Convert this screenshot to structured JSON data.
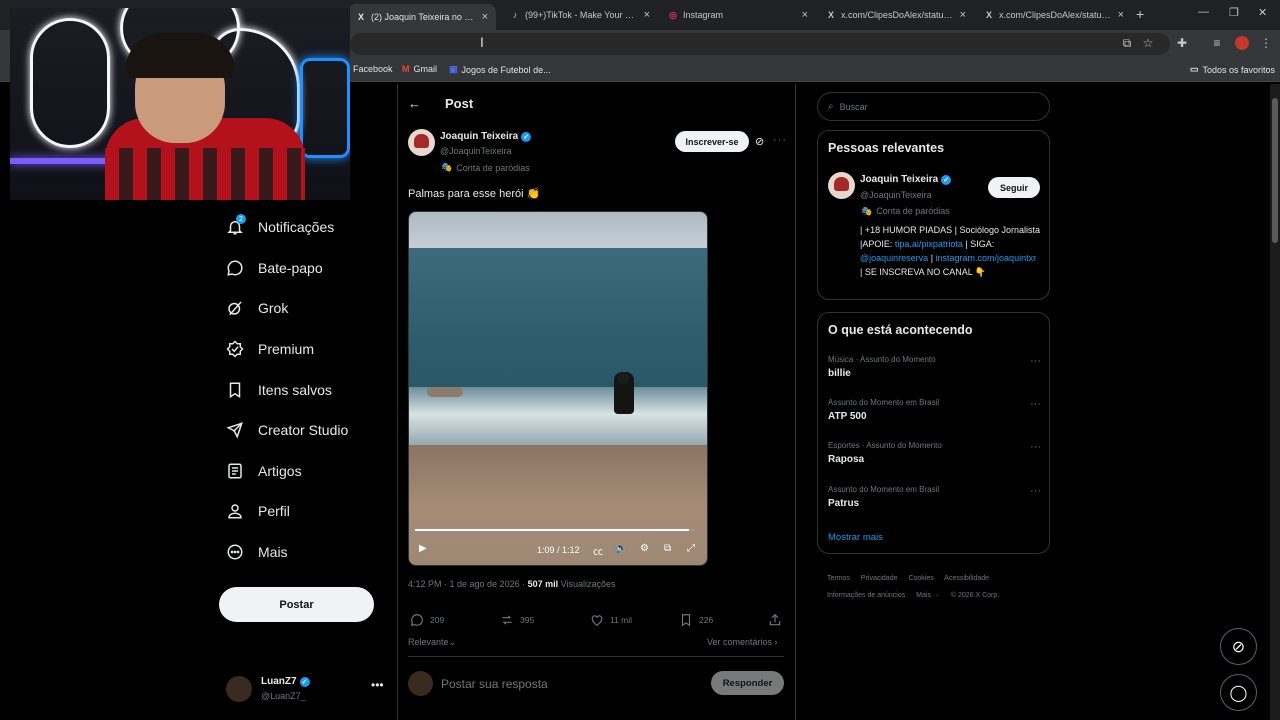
{
  "browser": {
    "tabs": [
      {
        "title": "(2) Joaquin Teixeira no X: \"Palm",
        "favicon": "X",
        "active": true
      },
      {
        "title": "(99+)TikTok - Make Your Day",
        "favicon": "♪",
        "active": false
      },
      {
        "title": "Instagram",
        "favicon": "◎",
        "active": false
      },
      {
        "title": "x.com/ClipesDoAlex/status/20",
        "favicon": "X",
        "active": false
      },
      {
        "title": "x.com/ClipesDoAlex/status/20",
        "favicon": "X",
        "active": false
      }
    ],
    "bookmarks": [
      {
        "label": "Facebook"
      },
      {
        "label": "Gmail"
      },
      {
        "label": "Jogos de Futebol de..."
      }
    ],
    "all_bookmarks": "Todos os favoritos"
  },
  "nav": {
    "items": [
      {
        "label": "Notificações",
        "icon": "bell-icon"
      },
      {
        "label": "Bate-papo",
        "icon": "chat-icon"
      },
      {
        "label": "Grok",
        "icon": "grok-icon"
      },
      {
        "label": "Premium",
        "icon": "premium-icon"
      },
      {
        "label": "Itens salvos",
        "icon": "bookmark-icon"
      },
      {
        "label": "Creator Studio",
        "icon": "rocket-icon"
      },
      {
        "label": "Artigos",
        "icon": "article-icon"
      },
      {
        "label": "Perfil",
        "icon": "person-icon"
      },
      {
        "label": "Mais",
        "icon": "more-circle-icon"
      }
    ],
    "notif_count": "2",
    "post_button": "Postar",
    "me": {
      "name": "LuanZ7",
      "handle": "@LuanZ7_"
    }
  },
  "post": {
    "header": "Post",
    "author_name": "Joaquin Teixeira",
    "author_handle": "@JoaquinTeixeira",
    "author_label": "Conta de paródias",
    "subscribe": "Inscrever-se",
    "text": "Palmas para esse herói 👏",
    "video_time": "1:09 / 1:12",
    "video_progress": 0.98,
    "time": "4:12 PM · 1 de ago de 2026 · ",
    "views": "507 mil",
    "views_label": " Visualizações",
    "replies": "209",
    "reposts": "395",
    "likes": "11 mil",
    "bookmarks": "226",
    "sort": "Relevante",
    "see_comments": "Ver comentários",
    "reply_placeholder": "Postar sua resposta",
    "reply_button": "Responder"
  },
  "sidebar": {
    "search_placeholder": "Buscar",
    "relevant": {
      "title": "Pessoas relevantes",
      "name": "Joaquin Teixeira",
      "handle": "@JoaquinTeixeira",
      "label": "Conta de paródias",
      "follow": "Seguir",
      "bio_1": "| +18 HUMOR PIADAS | Sociólogo Jornalista |APOIE: ",
      "bio_link1": "tipa.ai/pixpatriota",
      "bio_2": " | SIGA: ",
      "bio_link2": "@joaquinreserva",
      "bio_3": " | ",
      "bio_link3": "instagram.com/joaquintxr",
      "bio_4": " | SE INSCREVA NO CANAL 👇"
    },
    "trending": {
      "title": "O que está acontecendo",
      "items": [
        {
          "category": "Música · Assunto do Momento",
          "name": "billie"
        },
        {
          "category": "Assunto do Momento em Brasil",
          "name": "ATP 500"
        },
        {
          "category": "Esportes · Assunto do Momento",
          "name": "Raposa"
        },
        {
          "category": "Assunto do Momento em Brasil",
          "name": "Patrus"
        }
      ],
      "show_more": "Mostrar mais"
    },
    "footer": [
      "Termos",
      "Privacidade",
      "Cookies",
      "Acessibilidade",
      "Informações de anúncios",
      "Mais ···",
      "© 2026 X Corp."
    ]
  },
  "colors": {
    "accent": "#1d9bf0",
    "background": "#000000"
  }
}
